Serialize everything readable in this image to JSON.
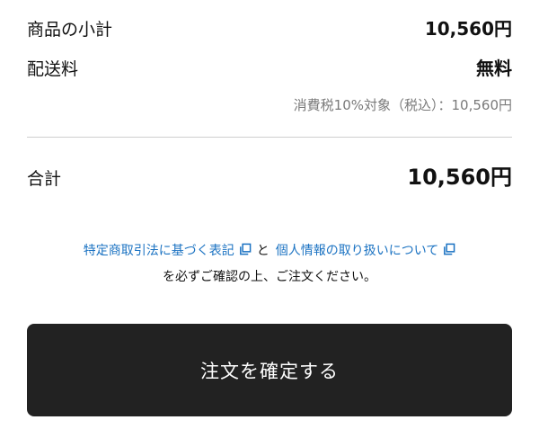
{
  "summary": {
    "subtotal_label": "商品の小計",
    "subtotal_value": "10,560円",
    "shipping_label": "配送料",
    "shipping_value": "無料",
    "tax_note": "消費税10%対象（税込）：10,560円",
    "total_label": "合計",
    "total_value": "10,560円"
  },
  "legal": {
    "link1": "特定商取引法に基づく表記",
    "and_text": "と",
    "link2": "個人情報の取り扱いについて",
    "note": "を必ずご確認の上、ご注文ください。"
  },
  "actions": {
    "confirm_label": "注文を確定する"
  },
  "icons": {
    "external_link": "external-copy-icon"
  },
  "colors": {
    "link": "#1a72c2",
    "button_bg": "#222222",
    "button_text": "#ffffff",
    "muted_text": "#7a7a7a",
    "divider": "#cfcfcf"
  }
}
